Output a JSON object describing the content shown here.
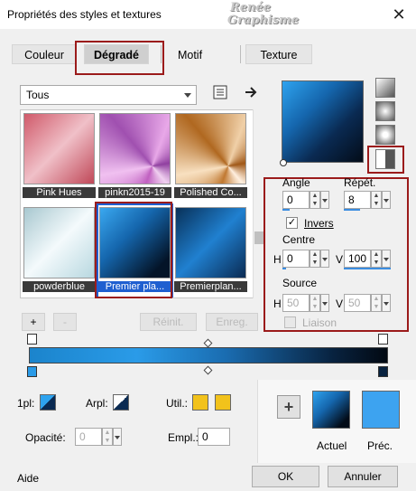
{
  "window": {
    "title": "Propriétés des styles et textures",
    "close_glyph": "✕",
    "watermark_line1": "Renée",
    "watermark_line2": "Graphisme"
  },
  "tabs": [
    {
      "label": "Couleur"
    },
    {
      "label": "Dégradé",
      "selected": true
    },
    {
      "label": "Motif"
    },
    {
      "label": "Texture"
    }
  ],
  "category": {
    "value": "Tous"
  },
  "gallery": [
    {
      "label": "Pink Hues"
    },
    {
      "label": "pinkn2015-19"
    },
    {
      "label": "Polished Co..."
    },
    {
      "label": "powderblue"
    },
    {
      "label": "Premier pla...",
      "selected": true
    },
    {
      "label": "Premierplan..."
    }
  ],
  "gallery_buttons": {
    "add": "+",
    "remove": "-",
    "reset": "Réinit.",
    "save": "Enreg."
  },
  "params": {
    "angle_label": "Angle",
    "angle_value": "0",
    "repeat_label": "Répét.",
    "repeat_value": "8",
    "invert_label": "Invers",
    "invert_checked": true,
    "center_label": "Centre",
    "center_h_label": "H",
    "center_h_value": "0",
    "center_v_label": "V",
    "center_v_value": "100",
    "source_label": "Source",
    "source_h_label": "H",
    "source_h_value": "50",
    "source_v_label": "V",
    "source_v_value": "50",
    "link_label": "Liaison",
    "link_checked": false
  },
  "bottom": {
    "first_label": "1pl:",
    "arpl_label": "Arpl:",
    "util_label": "Util.:",
    "opacity_label": "Opacité:",
    "opacity_value": "0",
    "empl_label": "Empl.:",
    "empl_value": "0",
    "plus_glyph": "+",
    "current_label": "Actuel",
    "previous_label": "Préc."
  },
  "footer": {
    "help": "Aide",
    "ok": "OK",
    "cancel": "Annuler"
  },
  "colors": {
    "accent_blue": "#1f5fd0",
    "highlight_red": "#9b1b1b",
    "util_yellow": "#f2c21b",
    "previous_blue": "#3da3f0"
  }
}
